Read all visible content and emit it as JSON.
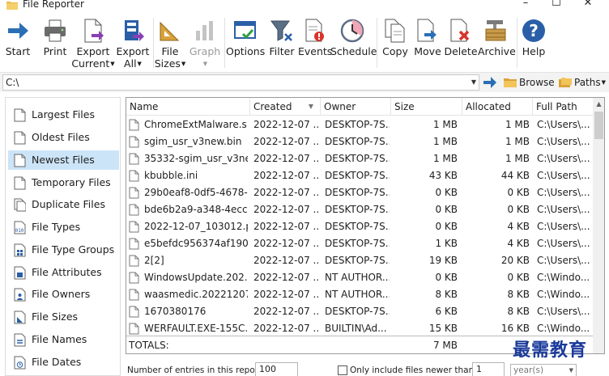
{
  "window": {
    "title": "File Reporter"
  },
  "toolbar": {
    "start": "Start",
    "print": "Print",
    "export_current_1": "Export",
    "export_current_2": "Current",
    "export_all_1": "Export",
    "export_all_2": "All",
    "file_sizes_1": "File",
    "file_sizes_2": "Sizes",
    "graph": "Graph",
    "options": "Options",
    "filter": "Filter",
    "events": "Events",
    "schedule": "Schedule",
    "copy": "Copy",
    "move": "Move",
    "delete": "Delete",
    "archive": "Archive",
    "help": "Help"
  },
  "pathbar": {
    "path": "C:\\",
    "browse": "Browse",
    "paths": "Paths"
  },
  "sidebar": {
    "items": [
      {
        "label": "Largest Files"
      },
      {
        "label": "Oldest Files"
      },
      {
        "label": "Newest Files"
      },
      {
        "label": "Temporary Files"
      },
      {
        "label": "Duplicate Files"
      },
      {
        "label": "File Types"
      },
      {
        "label": "File Type Groups"
      },
      {
        "label": "File Attributes"
      },
      {
        "label": "File Owners"
      },
      {
        "label": "File Sizes"
      },
      {
        "label": "File Names"
      },
      {
        "label": "File Dates"
      }
    ]
  },
  "grid": {
    "columns": [
      "Name",
      "Created",
      "Owner",
      "Size",
      "Allocated",
      "Full Path"
    ],
    "rows": [
      {
        "name": "ChromeExtMalware.s...",
        "created": "2022-12-07 ...",
        "owner": "DESKTOP-7S...",
        "size": "1 MB",
        "allocated": "1 MB",
        "path": "C:\\Users\\..."
      },
      {
        "name": "sgim_usr_v3new.bin",
        "created": "2022-12-07 ...",
        "owner": "DESKTOP-7S...",
        "size": "1 MB",
        "allocated": "1 MB",
        "path": "C:\\Users\\..."
      },
      {
        "name": "35332-sgim_usr_v3ne...",
        "created": "2022-12-07 ...",
        "owner": "DESKTOP-7S...",
        "size": "1 MB",
        "allocated": "1 MB",
        "path": "C:\\Users\\..."
      },
      {
        "name": "kbubble.ini",
        "created": "2022-12-07 ...",
        "owner": "DESKTOP-7S...",
        "size": "43 KB",
        "allocated": "44 KB",
        "path": "C:\\Users\\..."
      },
      {
        "name": "29b0eaf8-0df5-4678-...",
        "created": "2022-12-07 ...",
        "owner": "DESKTOP-7S...",
        "size": "0 KB",
        "allocated": "0 KB",
        "path": "C:\\Users\\..."
      },
      {
        "name": "bde6b2a9-a348-4ecc...",
        "created": "2022-12-07 ...",
        "owner": "DESKTOP-7S...",
        "size": "0 KB",
        "allocated": "0 KB",
        "path": "C:\\Users\\..."
      },
      {
        "name": "2022-12-07_103012.p...",
        "created": "2022-12-07 ...",
        "owner": "DESKTOP-7S...",
        "size": "0 KB",
        "allocated": "4 KB",
        "path": "C:\\Users\\..."
      },
      {
        "name": "e5befdc956374af190...",
        "created": "2022-12-07 ...",
        "owner": "DESKTOP-7S...",
        "size": "1 KB",
        "allocated": "4 KB",
        "path": "C:\\Users\\..."
      },
      {
        "name": "2[2]",
        "created": "2022-12-07 ...",
        "owner": "DESKTOP-7S...",
        "size": "19 KB",
        "allocated": "20 KB",
        "path": "C:\\Users\\..."
      },
      {
        "name": "WindowsUpdate.202...",
        "created": "2022-12-07 ...",
        "owner": "NT AUTHOR...",
        "size": "0 KB",
        "allocated": "0 KB",
        "path": "C:\\Windo..."
      },
      {
        "name": "waasmedic.20221207...",
        "created": "2022-12-07 ...",
        "owner": "NT AUTHOR...",
        "size": "8 KB",
        "allocated": "8 KB",
        "path": "C:\\Windo..."
      },
      {
        "name": "1670380176",
        "created": "2022-12-07 ...",
        "owner": "DESKTOP-7S...",
        "size": "6 KB",
        "allocated": "8 KB",
        "path": "C:\\Users\\..."
      },
      {
        "name": "WERFAULT.EXE-155C...",
        "created": "2022-12-07 ...",
        "owner": "BUILTIN\\Ad...",
        "size": "15 KB",
        "allocated": "16 KB",
        "path": "C:\\Windo..."
      }
    ],
    "totals": {
      "label": "TOTALS:",
      "size": "7 MB",
      "allocated": "7"
    }
  },
  "bottom": {
    "entries_label": "Number of entries in this report:",
    "entries_value": "100",
    "newer_label": "Only include files newer than:",
    "newer_value": "1",
    "unit": "year(s)"
  },
  "watermark": "最需教育"
}
